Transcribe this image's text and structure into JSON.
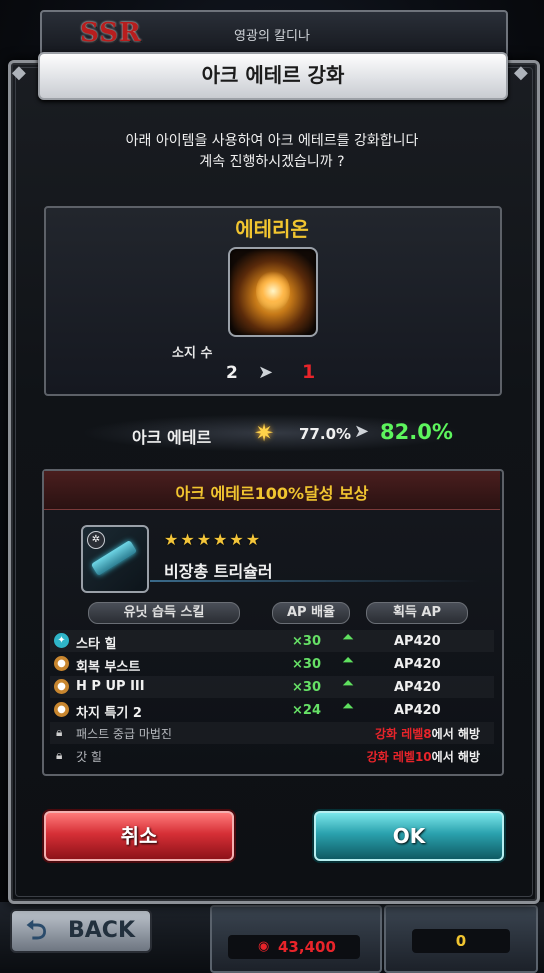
{
  "background": {
    "rarity": "SSR",
    "character_name": "영광의 칼디나",
    "back_label": "BACK",
    "gems": "43,400",
    "coins": "0"
  },
  "dialog": {
    "title": "아크 에테르 강화",
    "message_line1": "아래 아이템을 사용하여 아크 에테르를 강화합니다",
    "message_line2": "계속 진행하시겠습니까 ?",
    "item": {
      "name": "에테리온",
      "owned_label": "소지 수",
      "owned_from": "2",
      "owned_to": "1"
    },
    "ark": {
      "label": "아크 에테르",
      "from": "77.0%",
      "to": "82.0%"
    },
    "reward": {
      "title_prefix": "아크 에테르",
      "title_highlight": "100%",
      "title_suffix": "달성 보상",
      "stars": "★★★★★★",
      "weapon_name": "비장총 트리슐러",
      "col_skill": "유닛 습득 스킬",
      "col_mult": "AP 배율",
      "col_ap": "획득 AP",
      "skills": [
        {
          "name": "스타 힐",
          "mult": "×30",
          "ap": "AP420"
        },
        {
          "name": "회복 부스트",
          "mult": "×30",
          "ap": "AP420"
        },
        {
          "name": "H P UP III",
          "mult": "×30",
          "ap": "AP420"
        },
        {
          "name": "차지 특기 2",
          "mult": "×24",
          "ap": "AP420"
        }
      ],
      "locked": [
        {
          "name": "패스트 중급 마법진",
          "req": "강화 레벨8",
          "suffix": "에서 해방"
        },
        {
          "name": "갓 힐",
          "req": "강화 레벨10",
          "suffix": "에서 해방"
        }
      ]
    },
    "cancel_label": "취소",
    "ok_label": "OK"
  },
  "colors": {
    "gold": "#f1c530",
    "green": "#5df55d",
    "red": "#e8242a",
    "cancel": "#d62f36",
    "ok": "#2aa1ad"
  }
}
